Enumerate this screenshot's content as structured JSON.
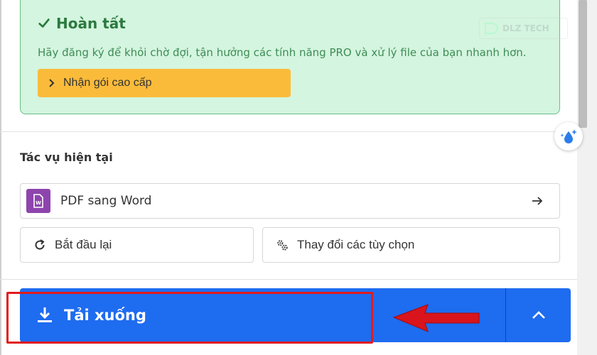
{
  "success_box": {
    "title": "Hoàn tất",
    "message": "Hãy đăng ký để khỏi chờ đợi, tận hưởng các tính năng PRO và xử lý file của bạn nhanh hơn.",
    "premium_label": "Nhận gói cao cấp",
    "watermark": "DLZ TECH"
  },
  "current_task": {
    "heading": "Tác vụ hiện tại",
    "task_label": "PDF sang Word",
    "restart_label": "Bắt đầu lại",
    "options_label": "Thay đổi các tùy chọn"
  },
  "download": {
    "label": "Tải xuống"
  },
  "colors": {
    "success_bg": "#d4f5df",
    "success_text": "#2b7a3f",
    "premium_bg": "#fbbb3a",
    "word_icon_bg": "#8e44ad",
    "download_bg": "#1e6cf0",
    "highlight": "#e11b1b"
  },
  "icons": {
    "check": "check-icon",
    "chevron": "chevron-right-icon",
    "word": "word-file-icon",
    "arrow": "arrow-right-icon",
    "restart": "restart-icon",
    "gears": "gears-icon",
    "download": "download-icon",
    "expand": "chevron-up-icon",
    "float": "water-drop-sparkle-icon"
  }
}
